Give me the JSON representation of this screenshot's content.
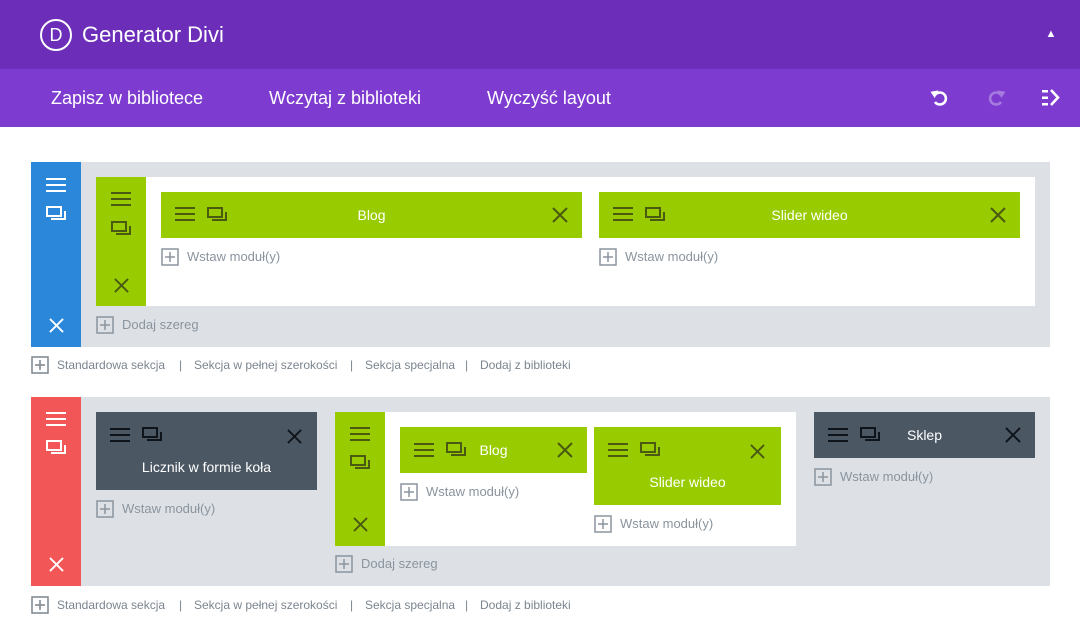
{
  "header": {
    "logo_letter": "D",
    "title": "Generator Divi",
    "collapse_icon": "triangle-up-icon"
  },
  "toolbar": {
    "save_to_library": "Zapisz w bibliotece",
    "load_from_library": "Wczytaj z biblioteki",
    "clear_layout": "Wyczyść layout",
    "icons": [
      "undo-icon",
      "redo-icon",
      "history-icon"
    ]
  },
  "colors": {
    "header_bg": "#6c2eb9",
    "toolbar_bg": "#7e3bd0",
    "section_blue": "#2b87da",
    "section_red": "#f25656",
    "row_green": "#99cc00",
    "module_dark": "#4b5763",
    "section_bg": "#dde1e6"
  },
  "section1": {
    "modules": [
      "Blog",
      "Slider wideo"
    ],
    "insert_module": "Wstaw moduł(y)",
    "add_row": "Dodaj szereg"
  },
  "section2": {
    "col1": {
      "module": "Licznik w formie koła",
      "insert_module": "Wstaw moduł(y)"
    },
    "inner_row": {
      "modules": [
        "Blog",
        "Slider wideo"
      ],
      "insert_module": "Wstaw moduł(y)",
      "add_row": "Dodaj szereg"
    },
    "col3": {
      "module": "Sklep",
      "insert_module": "Wstaw moduł(y)"
    }
  },
  "section_links": {
    "standard": "Standardowa sekcja",
    "fullwidth": "Sekcja w pełnej szerokości",
    "special": "Sekcja specjalna",
    "from_library": "Dodaj z biblioteki",
    "separator": "|"
  }
}
